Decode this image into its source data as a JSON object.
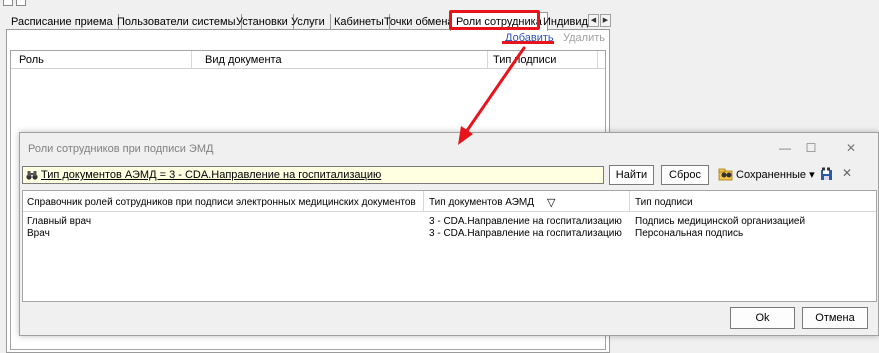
{
  "tabs": [
    {
      "label": "Расписание приема",
      "active": false
    },
    {
      "label": "Пользователи системы",
      "active": false
    },
    {
      "label": "Установки",
      "active": false
    },
    {
      "label": "Услуги",
      "active": false
    },
    {
      "label": "Кабинеты",
      "active": false
    },
    {
      "label": "Точки обмена",
      "active": false
    },
    {
      "label": "Роли сотрудника",
      "active": true
    },
    {
      "label": "Индивид",
      "active": false
    }
  ],
  "tab_scroll": {
    "left": "◀",
    "right": "▶"
  },
  "panel": {
    "add_link": "Добавить",
    "delete_link": "Удалить",
    "columns": [
      "Роль",
      "Вид документа",
      "Тип подписи"
    ]
  },
  "dialog": {
    "title": "Роли сотрудников при подписи ЭМД",
    "minimize": "—",
    "maximize": "☐",
    "close": "✕",
    "filter_text": "Тип документов АЭМД = 3 - CDA.Направление на госпитализацию",
    "find_button": "Найти",
    "reset_button": "Сброс",
    "saved_label": "Сохраненные ▾",
    "filter_close": "✕",
    "columns": [
      "Справочник ролей сотрудников при подписи электронных медицинских документов",
      "Тип документов АЭМД",
      "Тип подписи"
    ],
    "sort_icon": "▽",
    "rows": [
      {
        "role": "Главный врач",
        "doc_type": "3 - CDA.Направление на госпитализацию",
        "signature": "Подпись медицинской организацией"
      },
      {
        "role": "Врач",
        "doc_type": "3 - CDA.Направление на госпитализацию",
        "signature": "Персональная подпись"
      }
    ],
    "ok_button": "Ok",
    "cancel_button": "Отмена"
  },
  "colors": {
    "highlight": "#e8141b",
    "link": "#2a52be",
    "filter_bg": "#ffffe1"
  }
}
